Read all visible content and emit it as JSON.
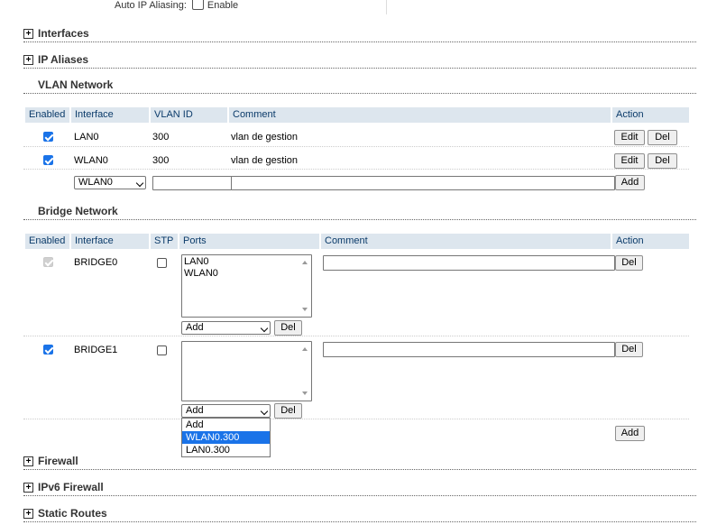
{
  "top": {
    "label": "Auto IP Aliasing:",
    "checkbox_label": "Enable"
  },
  "sections": {
    "interfaces": "Interfaces",
    "ip_aliases": "IP Aliases",
    "vlan": "VLAN Network",
    "bridge": "Bridge Network",
    "firewall": "Firewall",
    "ipv6_firewall": "IPv6 Firewall",
    "static_routes": "Static Routes"
  },
  "vlan": {
    "headers": {
      "enabled": "Enabled",
      "interface": "Interface",
      "vlan_id": "VLAN ID",
      "comment": "Comment",
      "action": "Action"
    },
    "rows": [
      {
        "interface": "LAN0",
        "vlan_id": "300",
        "comment": "vlan de gestion",
        "edit": "Edit",
        "del": "Del"
      },
      {
        "interface": "WLAN0",
        "vlan_id": "300",
        "comment": "vlan de gestion",
        "edit": "Edit",
        "del": "Del"
      }
    ],
    "new_row": {
      "interface_select": "WLAN0",
      "add": "Add"
    }
  },
  "bridge": {
    "headers": {
      "enabled": "Enabled",
      "interface": "Interface",
      "stp": "STP",
      "ports": "Ports",
      "comment": "Comment",
      "action": "Action"
    },
    "rows": [
      {
        "interface": "BRIDGE0",
        "ports": [
          "LAN0",
          "WLAN0"
        ],
        "add_select": "Add",
        "port_del": "Del",
        "del": "Del"
      },
      {
        "interface": "BRIDGE1",
        "ports": [],
        "add_select": "Add",
        "port_del": "Del",
        "del": "Del"
      }
    ],
    "dropdown_options": [
      "Add",
      "WLAN0.300",
      "LAN0.300"
    ],
    "add": "Add"
  }
}
